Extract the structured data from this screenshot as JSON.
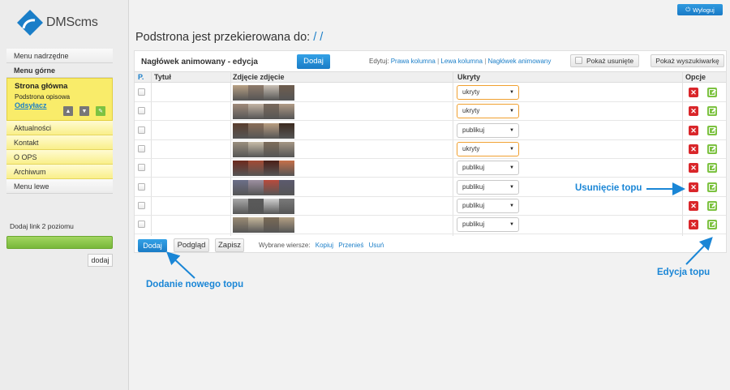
{
  "app": {
    "logo_text": "DMScms"
  },
  "topbar": {
    "logout_label": "Wyloguj"
  },
  "sidebar": {
    "items": [
      {
        "label": "Menu nadrzędne"
      },
      {
        "label": "Menu górne"
      },
      {
        "label": "Aktualności"
      },
      {
        "label": "Kontakt"
      },
      {
        "label": "O OPS"
      },
      {
        "label": "Archiwum"
      },
      {
        "label": "Menu lewe"
      }
    ],
    "active": {
      "title": "Strona główna",
      "subtitle": "Podstrona opisowa",
      "link": "Odsyłacz"
    },
    "add_link_label": "Dodaj link 2 poziomu",
    "add_button": "dodaj"
  },
  "page": {
    "title": "Podstrona jest przekierowana do:",
    "title_link": "/ /"
  },
  "panel": {
    "title": "Nagłówek animowany - edycja",
    "add_label": "Dodaj",
    "edit_prefix": "Edytuj:",
    "edit_links": [
      "Prawa kolumna",
      "Lewa kolumna",
      "Nagłówek animowany"
    ],
    "show_deleted": "Pokaż usunięte",
    "show_search": "Pokaż wyszukiwarkę",
    "columns": {
      "p": "P.",
      "title": "Tytuł",
      "image": "Zdjęcie zdjęcie",
      "hidden": "Ukryty",
      "options": "Opcje"
    },
    "rows": [
      {
        "hidden": "ukryty",
        "highlight": true
      },
      {
        "hidden": "ukryty",
        "highlight": true
      },
      {
        "hidden": "publikuj",
        "highlight": false
      },
      {
        "hidden": "ukryty",
        "highlight": true
      },
      {
        "hidden": "publikuj",
        "highlight": false
      },
      {
        "hidden": "publikuj",
        "highlight": false
      },
      {
        "hidden": "publikuj",
        "highlight": false
      },
      {
        "hidden": "publikuj",
        "highlight": false
      }
    ],
    "footer": {
      "add": "Dodaj",
      "preview": "Podgląd",
      "save": "Zapisz",
      "selected_label": "Wybrane wiersze:",
      "actions": [
        "Kopiuj",
        "Przenieś",
        "Usuń"
      ]
    }
  },
  "annotations": {
    "delete": "Usunięcie topu",
    "add": "Dodanie nowego topu",
    "edit": "Edycja topu"
  },
  "colors": {
    "accent": "#1a7ec8",
    "annotation": "#1a86d6",
    "active_menu": "#f9ec6a",
    "delete": "#d9262a",
    "edit": "#7dc241"
  }
}
